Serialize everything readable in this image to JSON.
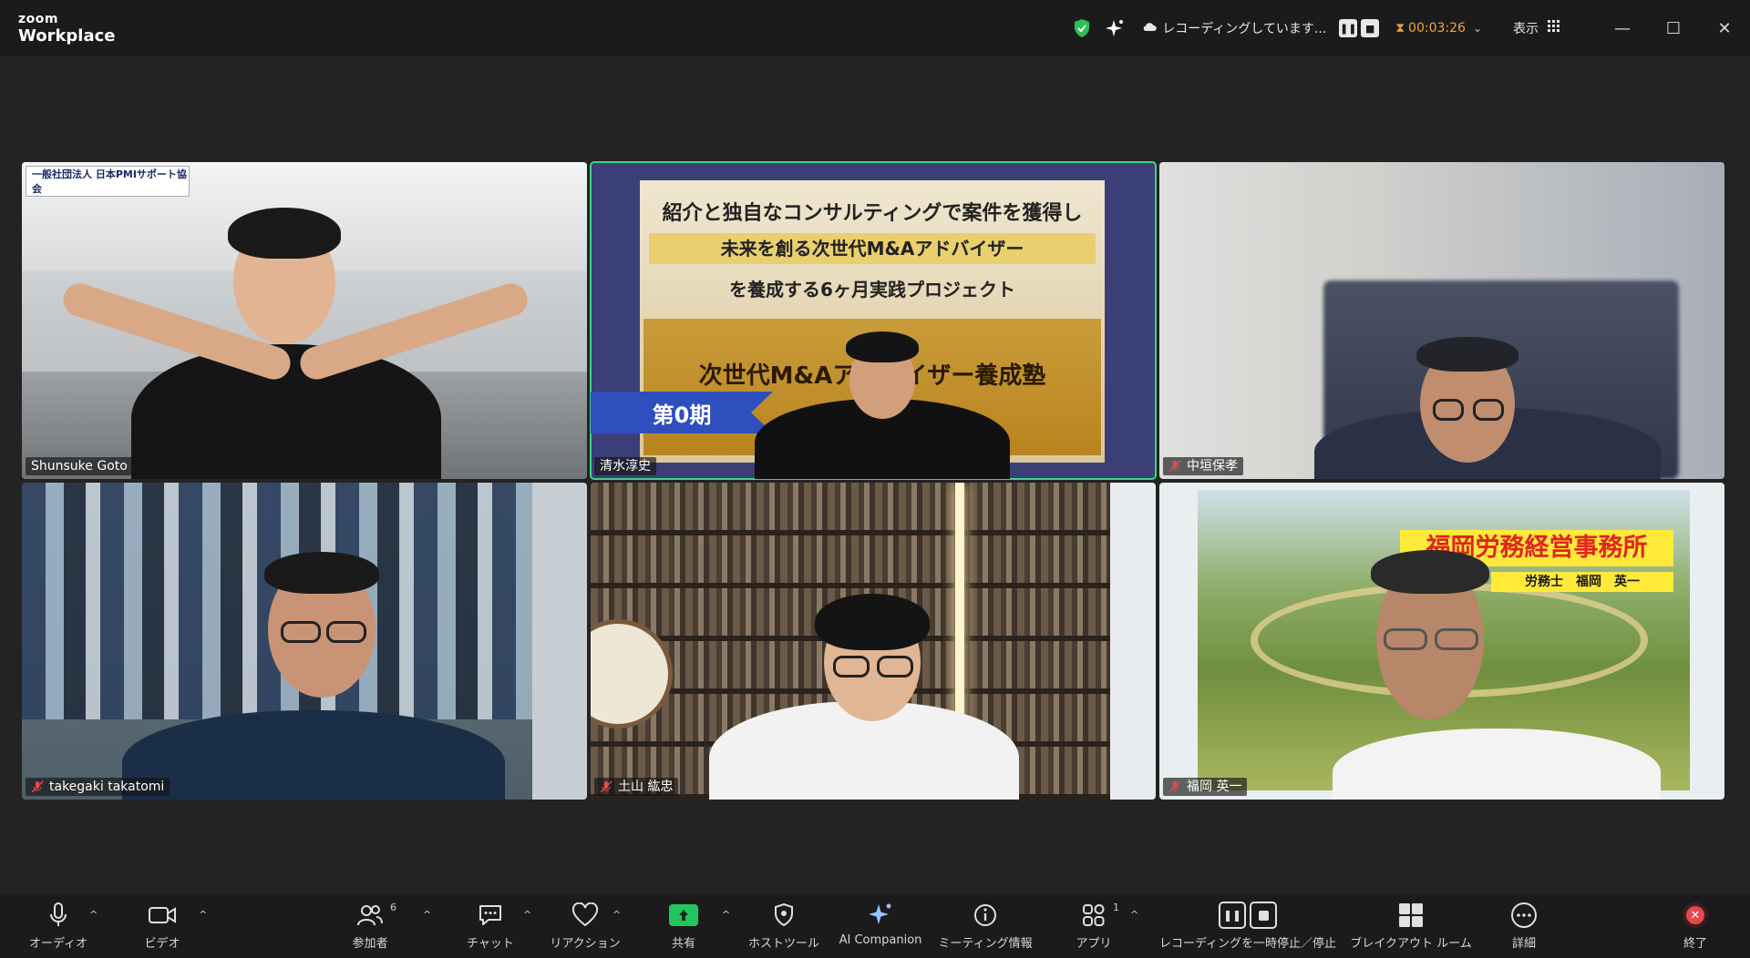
{
  "app": {
    "logo_top": "zoom",
    "logo_bottom": "Workplace"
  },
  "titlebar": {
    "icons": [
      "shield-check-icon",
      "sparkle-icon"
    ],
    "recording_status": "レコーディングしています...",
    "timer": "00:03:26",
    "view_label": "表示"
  },
  "participants": [
    {
      "name": "Shunsuke Goto",
      "muted": false,
      "active": false,
      "overlay_text": "一般社団法人 日本PMIサポート協会"
    },
    {
      "name": "清水淳史",
      "muted": false,
      "active": true,
      "banner": [
        "紹介と独自なコンサルティングで案件を獲得し",
        "未来を創る次世代M&Aアドバイザー",
        "を養成する6ヶ月実践プロジェクト",
        "次世代M&Aアドバイザー養成塾",
        "第0期"
      ]
    },
    {
      "name": "中垣保孝",
      "muted": true,
      "active": false
    },
    {
      "name": "takegaki takatomi",
      "muted": true,
      "active": false
    },
    {
      "name": "土山 紘忠",
      "muted": true,
      "active": false
    },
    {
      "name": "福岡 英一",
      "muted": true,
      "active": false,
      "banner_title": "福岡労務経営事務所",
      "banner_sub": "労務士　福岡　英一"
    }
  ],
  "toolbar": {
    "audio": "オーディオ",
    "video": "ビデオ",
    "participants": "参加者",
    "participants_count": "6",
    "chat": "チャット",
    "reactions": "リアクション",
    "share": "共有",
    "host_tools": "ホストツール",
    "ai_companion": "AI Companion",
    "meeting_info": "ミーティング情報",
    "apps": "アプリ",
    "apps_count": "1",
    "recording": "レコーディングを一時停止／停止",
    "breakout": "ブレイクアウト ルーム",
    "more": "詳細",
    "end": "終了"
  },
  "colors": {
    "accent_green": "#3fd18a",
    "timer_orange": "#f0a43a",
    "share_green": "#22c55e",
    "end_red": "#e5484d"
  }
}
